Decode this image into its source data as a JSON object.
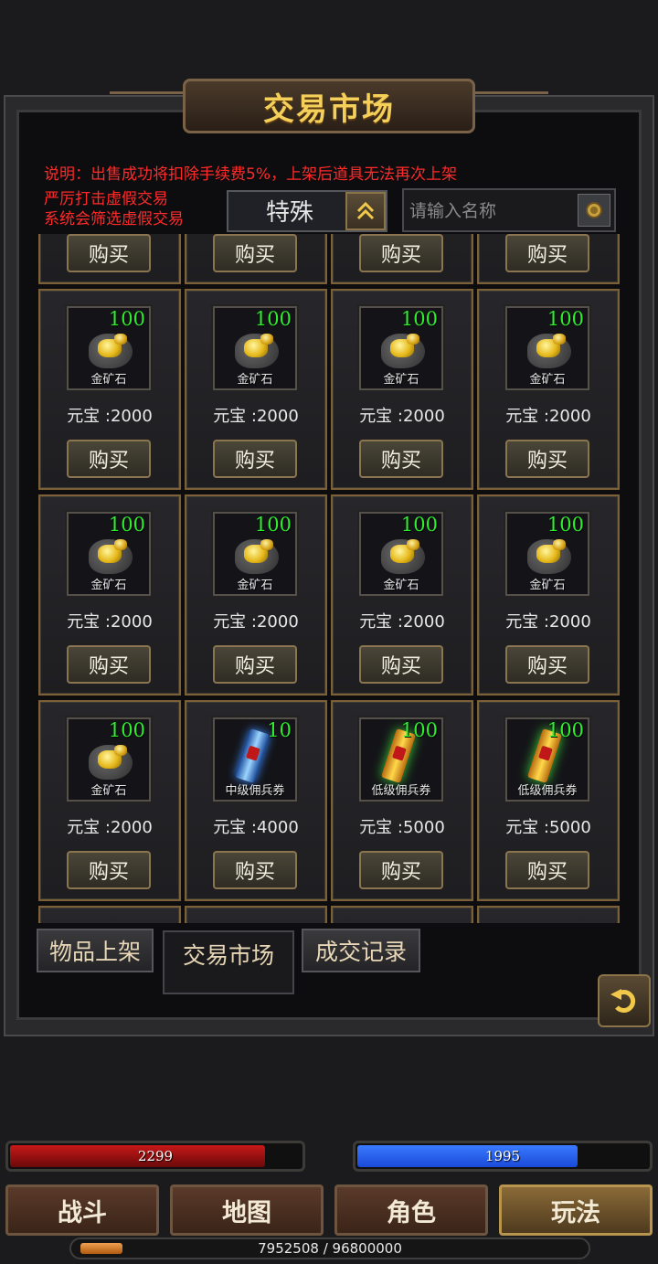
{
  "window": {
    "title": "交易市场"
  },
  "notice": {
    "line1": "说明：出售成功将扣除手续费5%，上架后道具无法再次上架",
    "line2": "严厉打击虚假交易",
    "line3": "系统会筛选虚假交易"
  },
  "filter": {
    "selected": "特殊",
    "toggle_icon": "double-chevron-up-icon"
  },
  "search": {
    "placeholder": "请输入名称",
    "value": "",
    "icon": "search-icon"
  },
  "buy_label": "购买",
  "items": [
    {
      "name": "金矿石",
      "qty": "100",
      "price": "元宝 :2000",
      "icon": "gold-ore-icon"
    },
    {
      "name": "金矿石",
      "qty": "100",
      "price": "元宝 :2000",
      "icon": "gold-ore-icon"
    },
    {
      "name": "金矿石",
      "qty": "100",
      "price": "元宝 :2000",
      "icon": "gold-ore-icon"
    },
    {
      "name": "金矿石",
      "qty": "100",
      "price": "元宝 :2000",
      "icon": "gold-ore-icon"
    },
    {
      "name": "金矿石",
      "qty": "100",
      "price": "元宝 :2000",
      "icon": "gold-ore-icon"
    },
    {
      "name": "金矿石",
      "qty": "100",
      "price": "元宝 :2000",
      "icon": "gold-ore-icon"
    },
    {
      "name": "金矿石",
      "qty": "100",
      "price": "元宝 :2000",
      "icon": "gold-ore-icon"
    },
    {
      "name": "金矿石",
      "qty": "100",
      "price": "元宝 :2000",
      "icon": "gold-ore-icon"
    },
    {
      "name": "金矿石",
      "qty": "100",
      "price": "元宝 :2000",
      "icon": "gold-ore-icon"
    },
    {
      "name": "中级佣兵券",
      "qty": "10",
      "price": "元宝 :4000",
      "icon": "blue-scroll-icon"
    },
    {
      "name": "低级佣兵券",
      "qty": "100",
      "price": "元宝 :5000",
      "icon": "gold-scroll-icon"
    },
    {
      "name": "低级佣兵券",
      "qty": "100",
      "price": "元宝 :5000",
      "icon": "gold-scroll-icon"
    }
  ],
  "tabs": [
    {
      "label": "物品上架",
      "active": false
    },
    {
      "label": "交易市场",
      "active": true
    },
    {
      "label": "成交记录",
      "active": false
    }
  ],
  "back_icon": "return-arrow-icon",
  "hp": {
    "value": "2299",
    "fraction": 0.88,
    "color": "#c81818"
  },
  "mp": {
    "value": "1995",
    "fraction": 0.76,
    "color": "#1a4ad8"
  },
  "nav": [
    {
      "label": "战斗",
      "active": false
    },
    {
      "label": "地图",
      "active": false
    },
    {
      "label": "角色",
      "active": false
    },
    {
      "label": "玩法",
      "active": true
    }
  ],
  "exp": {
    "text": "7952508 / 96800000",
    "fraction": 0.082
  }
}
